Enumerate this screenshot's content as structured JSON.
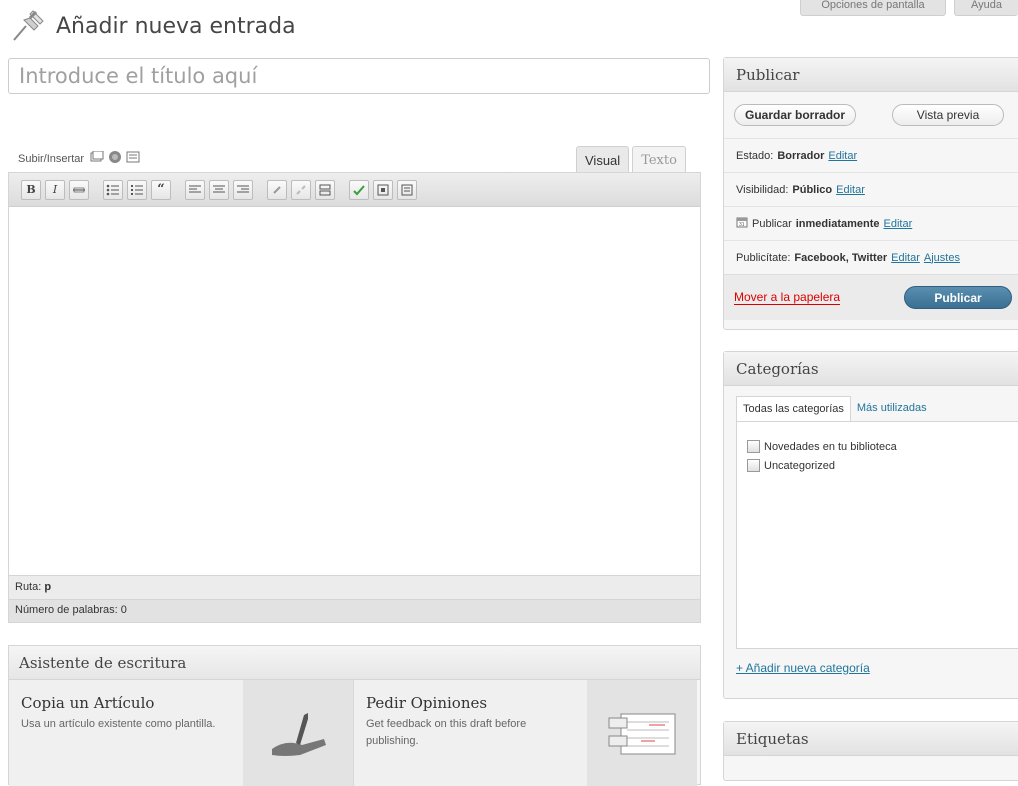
{
  "header": {
    "title": "Añadir nueva entrada",
    "screen_options_label": "Opciones de pantalla",
    "help_label": "Ayuda"
  },
  "title_field": {
    "placeholder": "Introduce el título aquí",
    "value": ""
  },
  "editor": {
    "media_label": "Subir/Insertar",
    "tabs": [
      "Visual",
      "Texto"
    ],
    "active_tab": "Visual",
    "toolbar_icons": [
      "bold",
      "italic",
      "strikethrough",
      "bullet-list",
      "numbered-list",
      "blockquote",
      "align-left",
      "align-center",
      "align-right",
      "link",
      "unlink",
      "more",
      "spellcheck",
      "fullscreen",
      "kitchen-sink"
    ],
    "path_label": "Ruta:",
    "path_value": "p",
    "word_count_label": "Número de palabras:",
    "word_count_value": "0"
  },
  "assistant": {
    "title": "Asistente de escritura",
    "cards": [
      {
        "title": "Copia un Artículo",
        "desc": "Usa un artículo existente como plantilla."
      },
      {
        "title": "Pedir Opiniones",
        "desc": "Get feedback on this draft before publishing."
      }
    ]
  },
  "publish_box": {
    "title": "Publicar",
    "save_draft": "Guardar borrador",
    "preview": "Vista previa",
    "status_label": "Estado:",
    "status_value": "Borrador",
    "visibility_label": "Visibilidad:",
    "visibility_value": "Público",
    "schedule_label": "Publicar",
    "schedule_value": "inmediatamente",
    "publicize_label": "Publicítate:",
    "publicize_value": "Facebook, Twitter",
    "edit_link": "Editar",
    "settings_link": "Ajustes",
    "trash": "Mover a la papelera",
    "publish": "Publicar"
  },
  "categories_box": {
    "title": "Categorías",
    "tabs": [
      "Todas las categorías",
      "Más utilizadas"
    ],
    "items": [
      "Novedades en tu biblioteca",
      "Uncategorized"
    ],
    "add_new": "+ Añadir nueva categoría"
  },
  "tags_box": {
    "title": "Etiquetas"
  },
  "colors": {
    "link": "#21759b",
    "publish_button": "#3b6f93",
    "trash": "#dd0000"
  }
}
